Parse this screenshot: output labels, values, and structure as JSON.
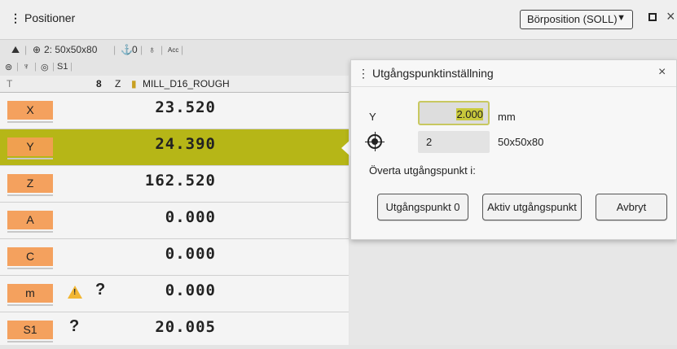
{
  "window": {
    "title": "Positioner",
    "mode_select": "Börposition (SOLL)"
  },
  "toolbar": {
    "workpiece": "2: 50x50x80",
    "preset": "0",
    "item4": "Acc"
  },
  "status": {
    "spindle": "S1"
  },
  "tool": {
    "col_t": "T",
    "number": "8",
    "axis": "Z",
    "name": "MILL_D16_ROUGH"
  },
  "axes": [
    {
      "label": "X",
      "value": "23.520"
    },
    {
      "label": "Y",
      "value": "24.390",
      "selected": true
    },
    {
      "label": "Z",
      "value": "162.520"
    },
    {
      "label": "A",
      "value": "0.000"
    },
    {
      "label": "C",
      "value": "0.000"
    },
    {
      "label": "m",
      "value": "0.000",
      "warning": true,
      "question": "?"
    },
    {
      "label": "S1",
      "value": "20.005",
      "question": "?"
    }
  ],
  "dialog": {
    "title": "Utgångspunktinställning",
    "field_label": "Y",
    "field_value": "2.000",
    "field_unit": "mm",
    "preset_value": "2",
    "preset_text": "50x50x80",
    "transfer_label": "Överta utgångspunkt i:",
    "buttons": {
      "preset0": "Utgångspunkt 0",
      "active": "Aktiv utgångspunkt",
      "cancel": "Avbryt"
    }
  },
  "colors": {
    "selection": "#b6b617",
    "axis_label": "#f4a15e",
    "warning": "#f2b632"
  },
  "icons": [
    "close-icon",
    "maximize-icon",
    "warning-icon",
    "preset-target-icon",
    "dropdown-arrow-icon"
  ]
}
